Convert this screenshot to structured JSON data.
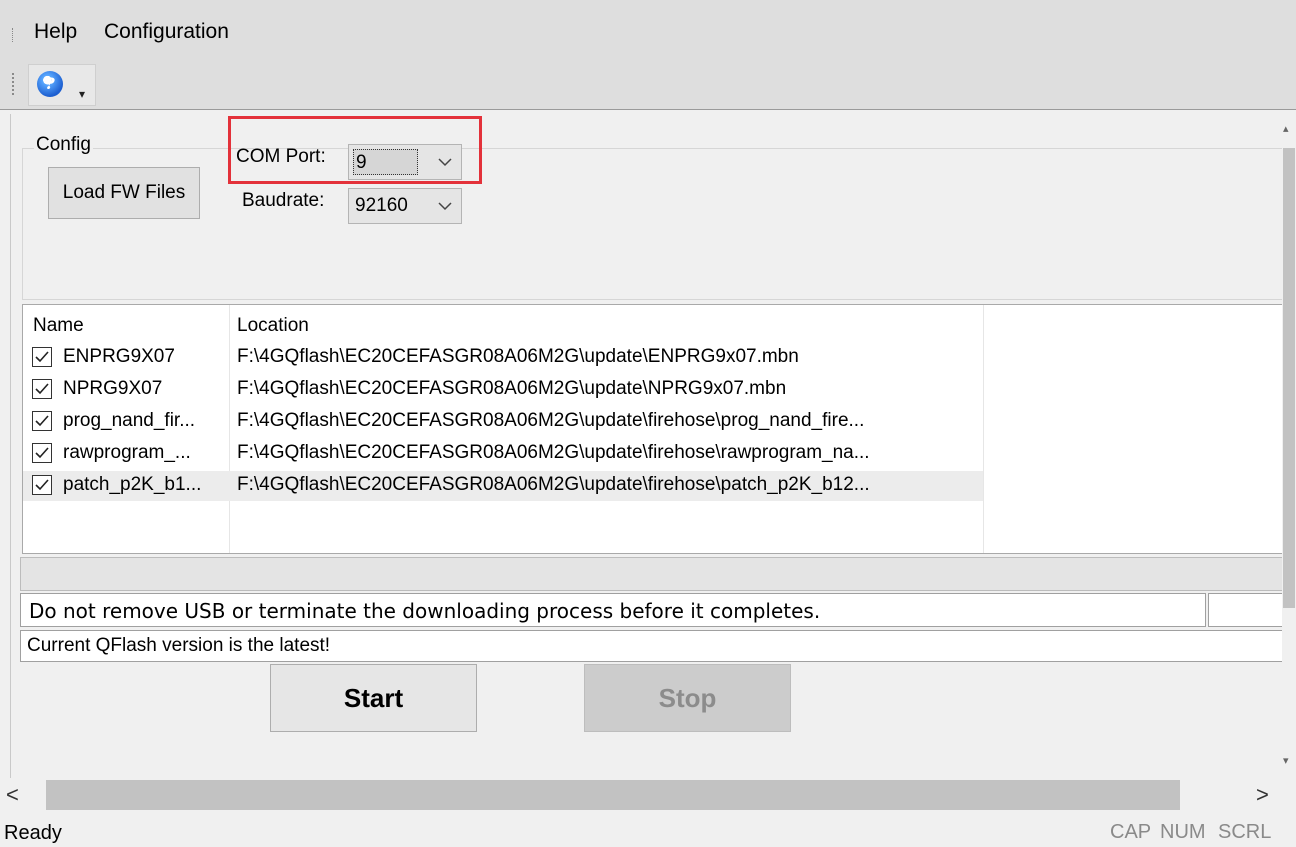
{
  "menu": {
    "help": "Help",
    "configuration": "Configuration"
  },
  "toolbar": {
    "help_icon": "help-question-icon"
  },
  "config": {
    "group_title": "Config",
    "load_button": "Load FW Files",
    "com_port_label": "COM Port:",
    "com_port_value": "9",
    "baudrate_label": "Baudrate:",
    "baudrate_value": "92160"
  },
  "file_list": {
    "headers": {
      "name": "Name",
      "location": "Location"
    },
    "rows": [
      {
        "checked": true,
        "name": "ENPRG9X07",
        "location": "F:\\4GQflash\\EC20CEFASGR08A06M2G\\update\\ENPRG9x07.mbn"
      },
      {
        "checked": true,
        "name": "NPRG9X07",
        "location": "F:\\4GQflash\\EC20CEFASGR08A06M2G\\update\\NPRG9x07.mbn"
      },
      {
        "checked": true,
        "name": "prog_nand_fir...",
        "location": "F:\\4GQflash\\EC20CEFASGR08A06M2G\\update\\firehose\\prog_nand_fire..."
      },
      {
        "checked": true,
        "name": "rawprogram_...",
        "location": "F:\\4GQflash\\EC20CEFASGR08A06M2G\\update\\firehose\\rawprogram_na..."
      },
      {
        "checked": true,
        "name": "patch_p2K_b1...",
        "location": "F:\\4GQflash\\EC20CEFASGR08A06M2G\\update\\firehose\\patch_p2K_b12..."
      }
    ]
  },
  "progress": {
    "fraction": 0
  },
  "messages": {
    "warning": "Do not remove USB or terminate the downloading process before it completes.",
    "version": "Current QFlash version is the latest!"
  },
  "actions": {
    "start": "Start",
    "stop": "Stop"
  },
  "scroll": {
    "left": "<",
    "right": ">"
  },
  "status": {
    "ready": "Ready",
    "cap": "CAP",
    "num": "NUM",
    "scrl": "SCRL"
  },
  "colors": {
    "highlight": "#e3313a"
  }
}
